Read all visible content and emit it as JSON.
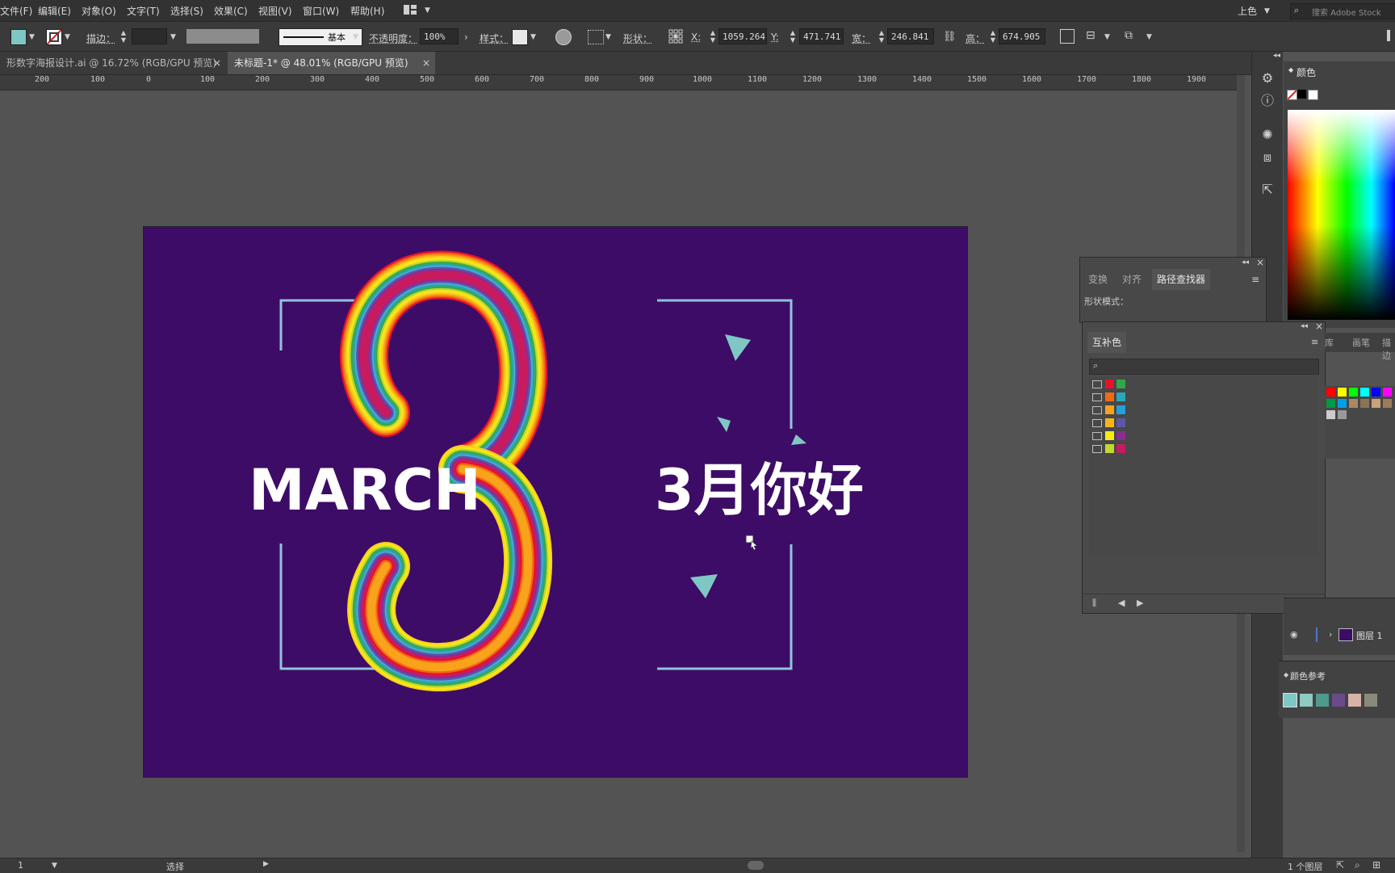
{
  "menu": {
    "items": [
      "文件(F)",
      "编辑(E)",
      "对象(O)",
      "文字(T)",
      "选择(S)",
      "效果(C)",
      "视图(V)",
      "窗口(W)",
      "帮助(H)"
    ],
    "workspace": "上色",
    "search_placeholder": "搜索 Adobe Stock"
  },
  "control": {
    "stroke_label": "描边：",
    "stroke_style": "基本",
    "opacity_label": "不透明度：",
    "opacity_value": "100%",
    "style_label": "样式：",
    "shape_label": "形状：",
    "x_label": "X:",
    "x_value": "1059.264",
    "y_label": "Y:",
    "y_value": "471.741",
    "w_label": "宽：",
    "w_value": "246.841",
    "h_label": "高：",
    "h_value": "674.905",
    "fill_color": "#7fc7c5"
  },
  "tabs": [
    {
      "label": "形数字海报设计.ai @ 16.72% (RGB/GPU 预览)",
      "active": false
    },
    {
      "label": "未标题-1* @ 48.01% (RGB/GPU 预览)",
      "active": true
    }
  ],
  "ruler": [
    "200",
    "100",
    "0",
    "100",
    "200",
    "300",
    "400",
    "500",
    "600",
    "700",
    "800",
    "900",
    "1000",
    "1100",
    "1200",
    "1300",
    "1400",
    "1500",
    "1600",
    "1700",
    "1800",
    "1900"
  ],
  "artwork": {
    "left_text": "MARCH",
    "right_text": "3月你好",
    "background": "#3d0c66",
    "frame_color": "#8fc3dc",
    "accent": "#7fc7c5",
    "rainbow": [
      "#e8112d",
      "#f06a14",
      "#f9a21b",
      "#fcd11c",
      "#f7ea16",
      "#c3d82c",
      "#3aa94a",
      "#27a69b",
      "#4aa6d8",
      "#5b56a6",
      "#8a2d93",
      "#c81b5f"
    ]
  },
  "pathfinder_panel": {
    "tabs": [
      "变换",
      "对齐",
      "路径查找器"
    ],
    "shape_mode_label": "形状模式："
  },
  "harmony_panel": {
    "title": "互补色",
    "side_tabs": [
      "库",
      "画笔",
      "描边"
    ],
    "rows": [
      [
        "#e8112d",
        "#2ea84a"
      ],
      [
        "#f06a14",
        "#2aa8b8"
      ],
      [
        "#f9a21b",
        "#24a0dc"
      ],
      [
        "#f7b51c",
        "#5b56a6"
      ],
      [
        "#f7ea16",
        "#8a2d93"
      ],
      [
        "#c3d82c",
        "#c81b5f"
      ]
    ]
  },
  "color_panel": {
    "title": "颜色"
  },
  "layers_panel": {
    "layer_name": "图层 1"
  },
  "color_guide": {
    "title": "颜色参考",
    "swatches": [
      "#7fc7c5",
      "#8ec9c2",
      "#4e9a8d",
      "#6a4a8a",
      "#d8b3a8",
      "#8a8a7a"
    ]
  },
  "swatch_grid": [
    "#ff0000",
    "#ffff00",
    "#00ff00",
    "#00ffff",
    "#0000ff",
    "#ff00ff",
    "#009944",
    "#00a0e9",
    "#aa8866",
    "#8b7355",
    "#c8a27a",
    "#9c7b5b",
    "#cccccc",
    "#999999"
  ],
  "status": {
    "page": "1",
    "tool": "选择",
    "layers_count": "1 个图层"
  }
}
